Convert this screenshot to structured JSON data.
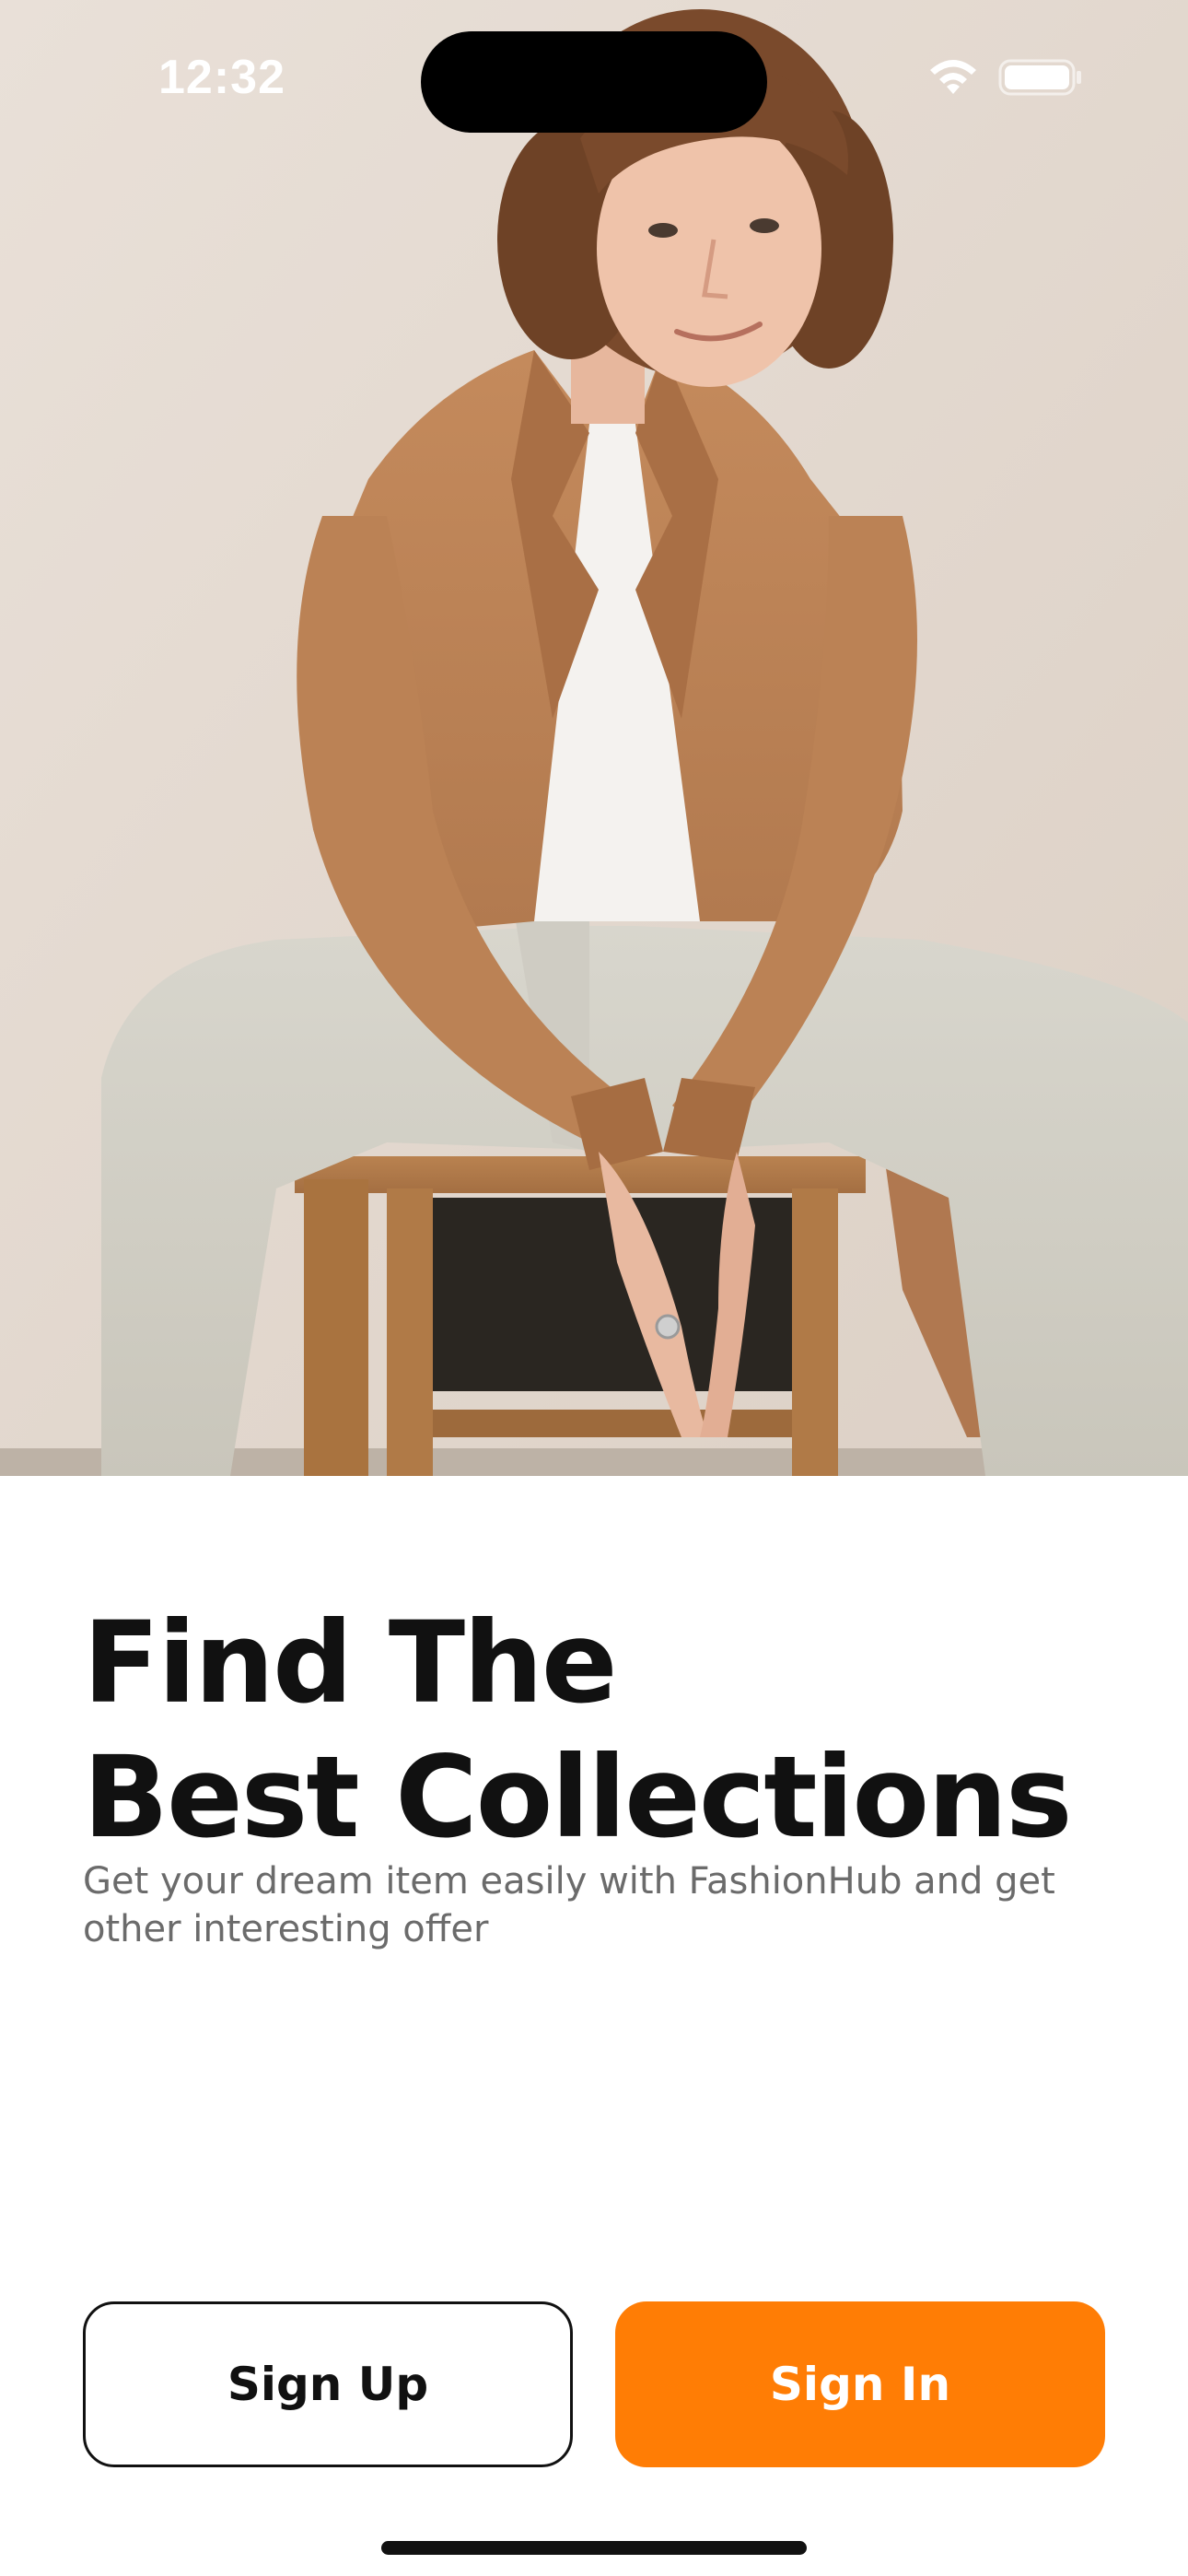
{
  "status_bar": {
    "time": "12:32",
    "wifi_icon": "wifi-icon",
    "battery_icon": "battery-icon"
  },
  "hero": {
    "image": "model-photo"
  },
  "content": {
    "headline_line1": "Find The",
    "headline_line2": "Best Collections",
    "subtitle": "Get your dream item easily with FashionHub and get other interesting offer"
  },
  "actions": {
    "sign_up_label": "Sign Up",
    "sign_in_label": "Sign In"
  },
  "colors": {
    "accent": "#ff7d05",
    "text_primary": "#111111",
    "text_secondary": "#6b6b6b",
    "background": "#ffffff"
  }
}
